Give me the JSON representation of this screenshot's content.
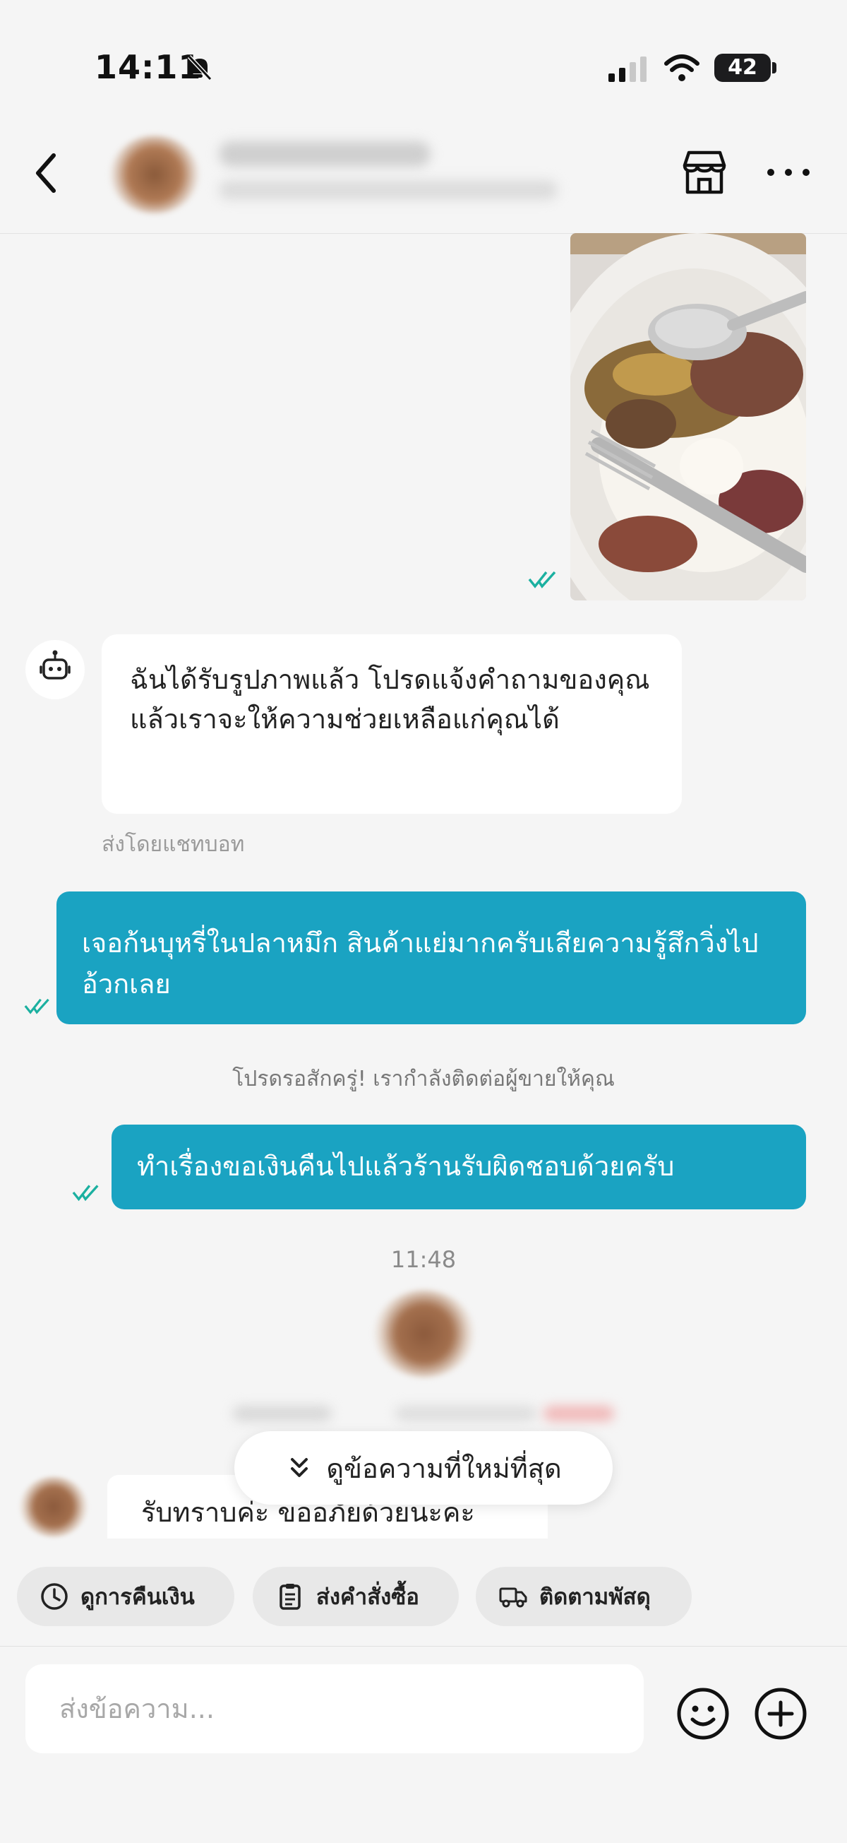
{
  "status_bar": {
    "time": "14:11",
    "battery": "42"
  },
  "header": {
    "back_icon": "chevron-left-icon",
    "store_icon": "store-icon",
    "more_icon": "more-horizontal-icon"
  },
  "messages": {
    "bot_message": "ฉันได้รับรูปภาพแล้ว โปรดแจ้งคำถามของคุณ แล้วเราจะให้ความช่วยเหลือแก่คุณได้",
    "bot_sender": "ส่งโดยแชทบอท",
    "sent_1": "เจอก้นบุหรี่ในปลาหมึก สินค้าแย่มากครับเสียความรู้สึกวิ่งไปอ้วกเลย",
    "system_note": "โปรดรอสักครู่! เรากำลังติดต่อผู้ขายให้คุณ",
    "sent_2": "ทำเรื่องขอเงินคืนไปแล้วร้านรับผิดชอบด้วยครับ",
    "timestamp": "11:48",
    "seller_reply": "รับทราบค่ะ ขออภัยด้วยนะคะ"
  },
  "new_messages_button": "ดูข้อความที่ใหม่ที่สุด",
  "quick_actions": [
    {
      "label": "ดูการคืนเงิน",
      "icon": "clock-icon"
    },
    {
      "label": "ส่งคำสั่งซื้อ",
      "icon": "clipboard-icon"
    },
    {
      "label": "ติดตามพัสดุ",
      "icon": "truck-icon"
    }
  ],
  "input": {
    "placeholder": "ส่งข้อความ..."
  },
  "colors": {
    "sent_bubble": "#1aa3c2",
    "read_tick": "#1bb0a0",
    "background": "#f5f5f5"
  }
}
